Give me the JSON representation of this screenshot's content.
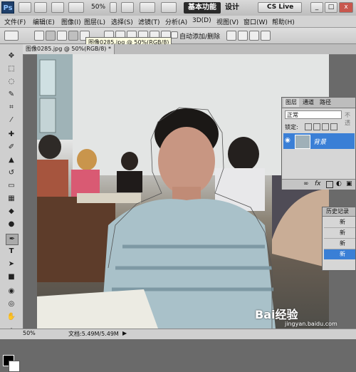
{
  "appbar": {
    "logo": "Ps",
    "zoom": "50%",
    "workspace_active": "基本功能",
    "workspace_other": "设计",
    "cslive": "CS Live",
    "window_controls": [
      "_",
      "□",
      "x"
    ]
  },
  "menu": [
    "文件(F)",
    "编辑(E)",
    "图像(I)",
    "图层(L)",
    "选择(S)",
    "滤镜(T)",
    "分析(A)",
    "3D(D)",
    "视图(V)",
    "窗口(W)",
    "帮助(H)"
  ],
  "options": {
    "auto_label": "自动添加/删除"
  },
  "tooltip": "图像0285.jpg @ 50%(RGB/8)",
  "doc_tab": {
    "title": "图像0285.jpg @ 50%(RGB/8) *",
    "close": "x"
  },
  "layers_panel": {
    "tabs": [
      "图层",
      "通道",
      "路径"
    ],
    "blend_mode": "正常",
    "opacity_label": "不透",
    "lock_label": "锁定:",
    "layer_name": "背景"
  },
  "history_panel": {
    "title": "历史记录",
    "items": [
      "新",
      "新",
      "新",
      "新"
    ]
  },
  "status": {
    "zoom": "50%",
    "doc_info": "文档:5.49M/5.49M"
  },
  "watermark": {
    "text": "Bai经验",
    "url": "jingyan.baidu.com"
  },
  "colors": {
    "layer_selected": "#3a7fd6",
    "app_bg": "#6a6a6a"
  }
}
